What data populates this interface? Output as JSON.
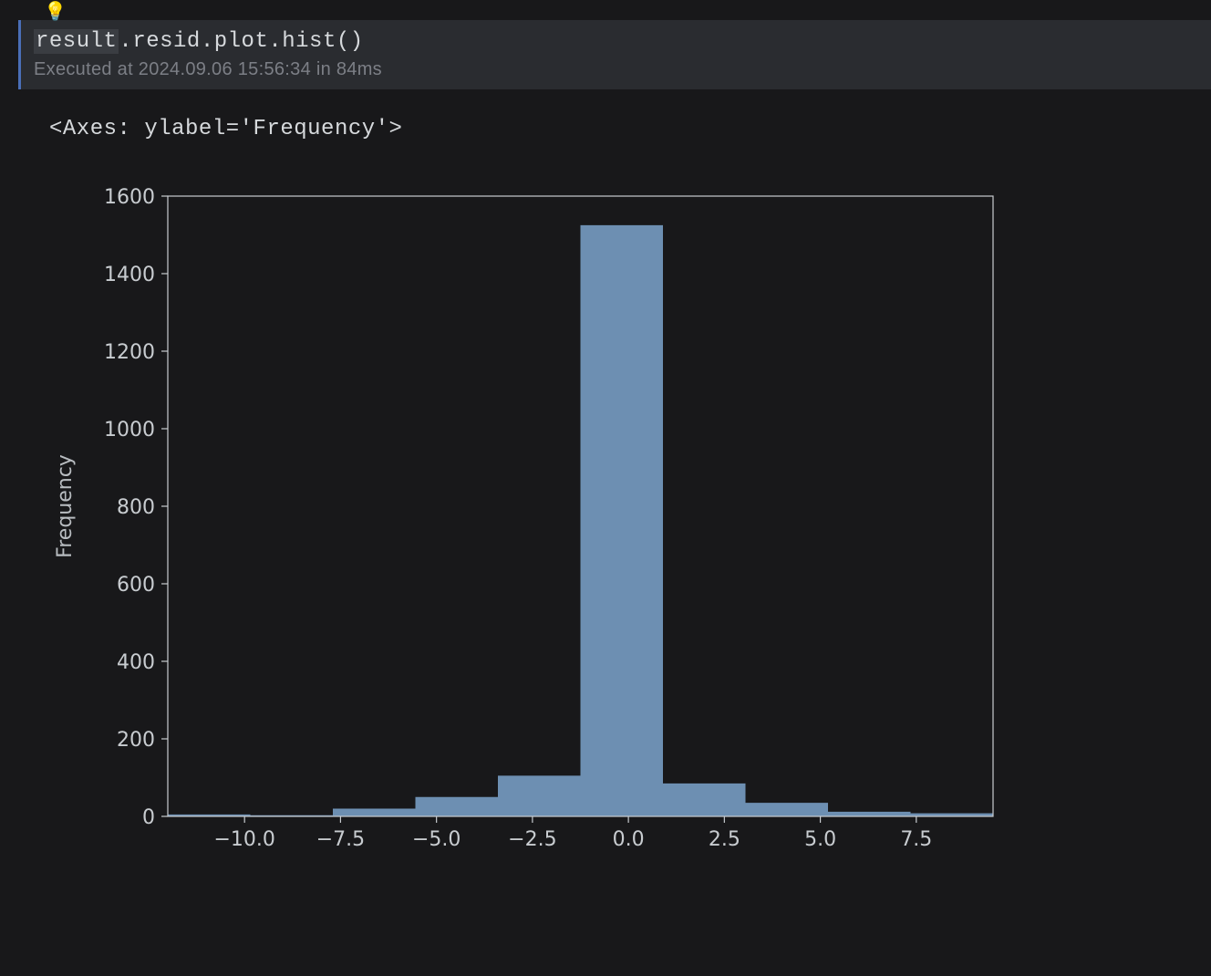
{
  "icons": {
    "lightbulb": "💡"
  },
  "code": {
    "highlighted_prefix": "result",
    "rest": ".resid.plot.hist()"
  },
  "execution": {
    "text": "Executed at 2024.09.06 15:56:34 in 84ms"
  },
  "output": {
    "repr": "<Axes: ylabel='Frequency'>"
  },
  "chart_data": {
    "type": "bar",
    "title": "",
    "xlabel": "",
    "ylabel": "Frequency",
    "xlim": [
      -12.0,
      9.5
    ],
    "ylim": [
      0,
      1600
    ],
    "x_ticks": [
      -10.0,
      -7.5,
      -5.0,
      -2.5,
      0.0,
      2.5,
      5.0,
      7.5
    ],
    "y_ticks": [
      0,
      200,
      400,
      600,
      800,
      1000,
      1200,
      1400,
      1600
    ],
    "bin_edges": [
      -12.0,
      -9.85,
      -7.7,
      -5.55,
      -3.4,
      -1.25,
      0.9,
      3.05,
      5.2,
      7.35,
      9.5
    ],
    "values": [
      5,
      3,
      20,
      50,
      105,
      1525,
      85,
      35,
      12,
      8
    ],
    "bar_color": "#6d8fb2"
  }
}
